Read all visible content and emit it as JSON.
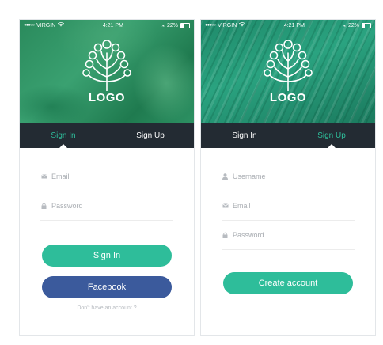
{
  "status_bar": {
    "carrier": "VIRGIN",
    "time": "4:21 PM",
    "battery": "22%"
  },
  "brand": {
    "logo_text": "LOGO"
  },
  "colors": {
    "accent": "#2ebd9a",
    "facebook": "#3b5a9c",
    "tab_bar": "#232b33"
  },
  "screens": [
    {
      "tabs": [
        {
          "label": "Sign In",
          "active": true
        },
        {
          "label": "Sign Up",
          "active": false
        }
      ],
      "fields": [
        {
          "placeholder": "Email",
          "icon": "envelope-icon"
        },
        {
          "placeholder": "Password",
          "icon": "lock-icon"
        }
      ],
      "primary_button": "Sign In",
      "facebook_button": "Facebook",
      "footer_note": "Don't have an account ?"
    },
    {
      "tabs": [
        {
          "label": "Sign In",
          "active": false
        },
        {
          "label": "Sign Up",
          "active": true
        }
      ],
      "fields": [
        {
          "placeholder": "Username",
          "icon": "user-icon"
        },
        {
          "placeholder": "Email",
          "icon": "envelope-icon"
        },
        {
          "placeholder": "Password",
          "icon": "lock-icon"
        }
      ],
      "primary_button": "Create account"
    }
  ]
}
